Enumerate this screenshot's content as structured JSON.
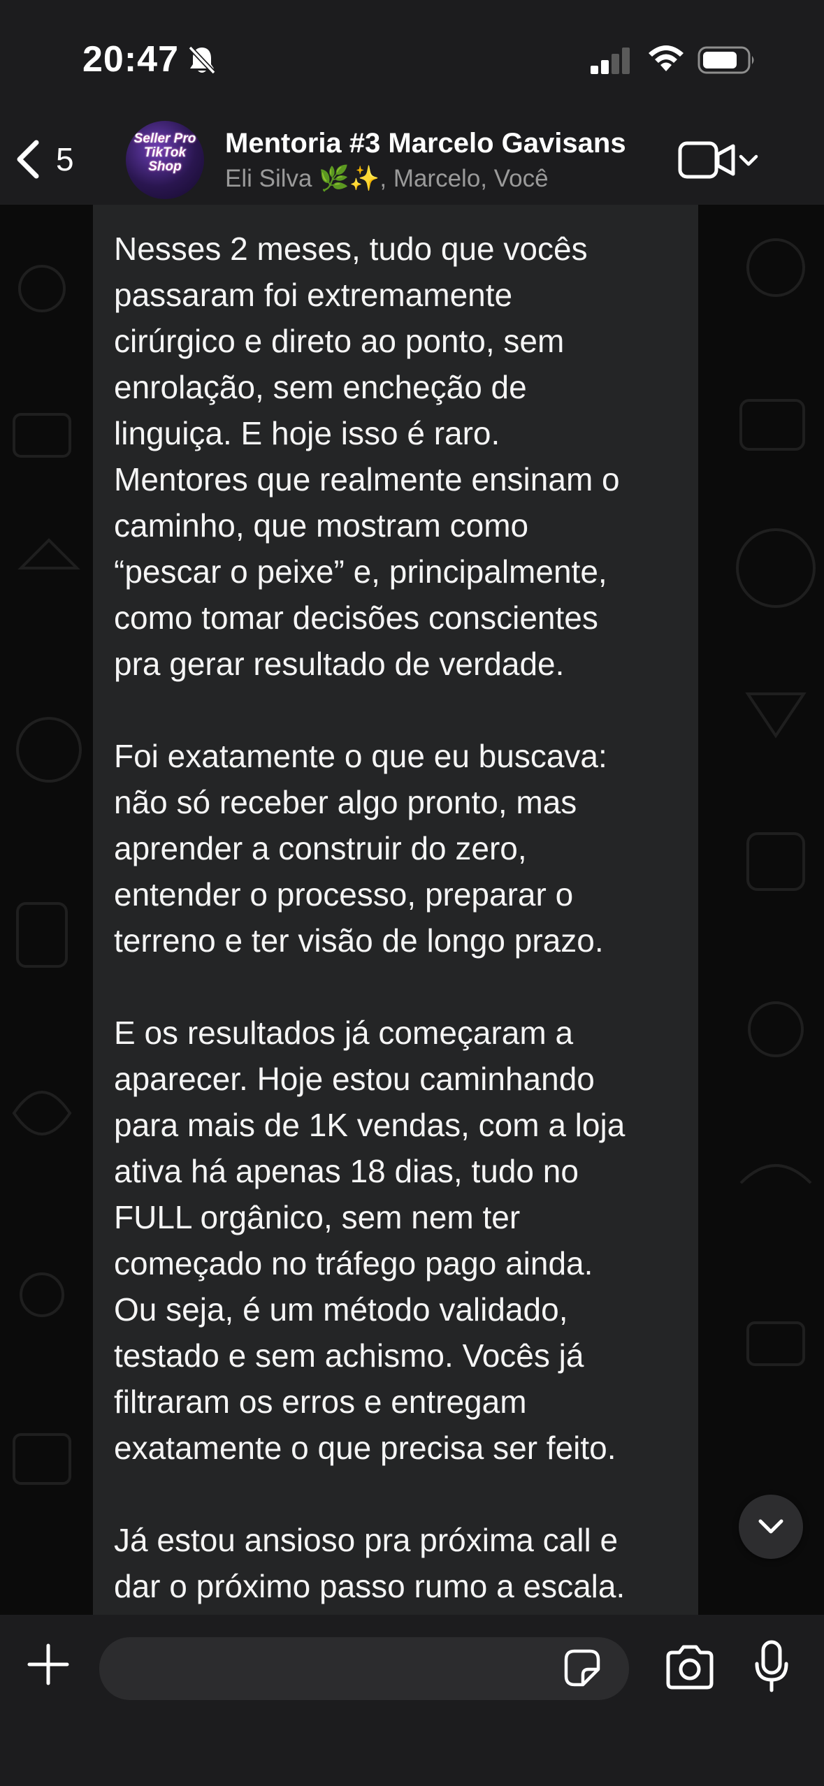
{
  "status_bar": {
    "time": "20:47",
    "icons": [
      "bell-slash-icon",
      "cellular-signal-icon",
      "wifi-icon",
      "battery-icon"
    ]
  },
  "header": {
    "back_count": "5",
    "title": "Mentoria #3 Marcelo Gavisans",
    "subtitle": "Eli Silva 🌿✨, Marcelo, Você",
    "avatar_text": "Seller Pro TikTok Shop",
    "icons": [
      "chevron-left-icon",
      "video-camera-icon",
      "chevron-down-icon"
    ]
  },
  "message": {
    "text": "Nesses 2 meses, tudo que vocês\npassaram foi extremamente\ncirúrgico e direto ao ponto, sem\nenrolação, sem encheção de\nlinguiça. E hoje isso é raro.\nMentores que realmente ensinam o\ncaminho, que mostram como\n“pescar o peixe” e, principalmente,\ncomo tomar decisões conscientes\npra gerar resultado de verdade.\n\nFoi exatamente o que eu buscava:\nnão só receber algo pronto, mas\naprender a construir do zero,\nentender o processo, preparar o\nterreno e ter visão de longo prazo.\n\nE os resultados já começaram a\naparecer. Hoje estou caminhando\npara mais de 1K vendas, com a loja\nativa há apenas 18 dias, tudo no\nFULL orgânico, sem nem ter\ncomeçado no tráfego pago ainda.\nOu seja, é um método validado,\ntestado e sem achismo. Vocês já\nfiltraram os erros e entregam\nexatamente o que precisa ser feito.\n\nJá estou ansioso pra próxima call e\ndar o próximo passo rumo a escala."
  },
  "composer": {
    "input_value": "",
    "icons": [
      "plus-icon",
      "sticker-icon",
      "camera-icon",
      "microphone-icon"
    ]
  },
  "scroll_down_icon": "chevron-down-icon",
  "colors": {
    "background": "#0b0b0b",
    "bar": "#1c1c1e",
    "bubble": "#242526",
    "text": "#f5f5f5",
    "subtitle": "#9a9a9a"
  }
}
